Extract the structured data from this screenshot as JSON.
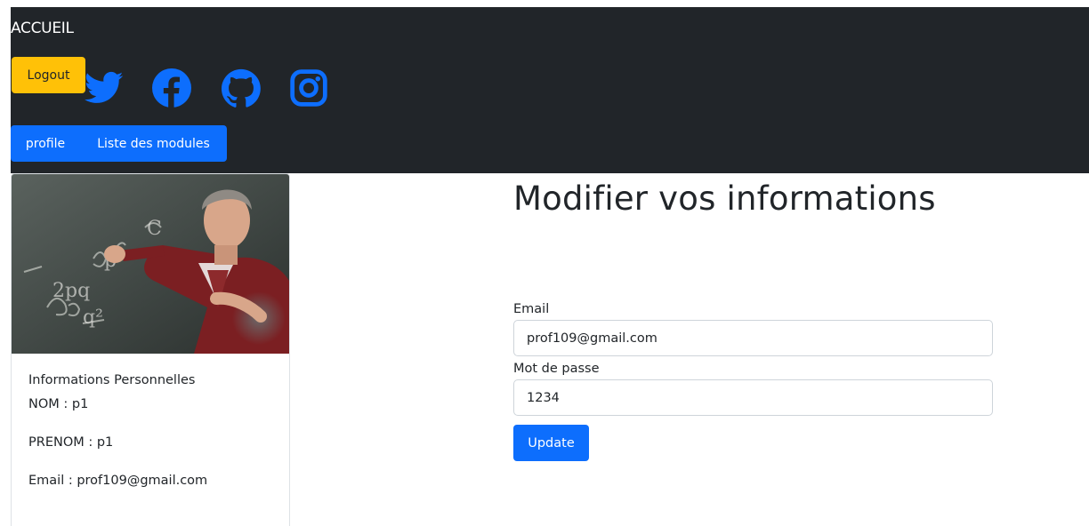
{
  "navbar": {
    "brand": "ACCUEIL",
    "logout_label": "Logout",
    "social_icons": [
      "twitter-icon",
      "facebook-icon",
      "github-icon",
      "instagram-icon"
    ],
    "links": {
      "profile": "profile",
      "modules": "Liste des modules"
    }
  },
  "profile_card": {
    "info_title": "Informations Personnelles",
    "nom": "NOM : p1",
    "prenom": "PRENOM : p1",
    "email": "Email : prof109@gmail.com"
  },
  "form": {
    "title": "Modifier vos informations",
    "email_label": "Email",
    "email_value": "prof109@gmail.com",
    "password_label": "Mot de passe",
    "password_value": "1234",
    "submit_label": "Update"
  },
  "colors": {
    "navbar_bg": "#212529",
    "primary": "#0d6efd",
    "warning": "#ffc107"
  }
}
